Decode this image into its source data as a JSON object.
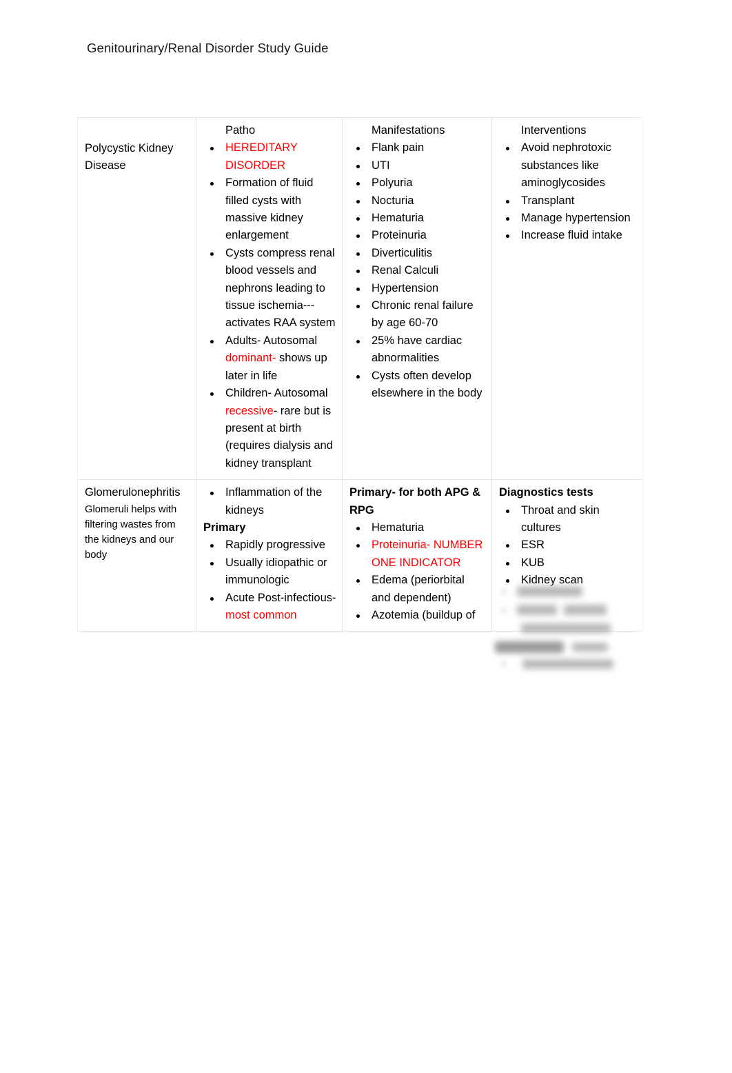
{
  "document": {
    "title": "Genitourinary/Renal Disorder Study Guide"
  },
  "colors": {
    "highlight_red": "#ff0000",
    "text": "#000000",
    "table_border": "#e2e2e2"
  },
  "table": {
    "headers": {
      "col1": "",
      "col2": "Patho",
      "col3": "Manifestations",
      "col4": "Interventions"
    },
    "rows": [
      {
        "name": "polycystic-kidney-disease",
        "disorder": {
          "title": "Polycystic Kidney Disease",
          "note": ""
        },
        "patho": {
          "bullets": [
            {
              "text": "HEREDITARY DISORDER",
              "color": "red"
            },
            {
              "text": "Formation of fluid filled cysts with massive kidney enlargement"
            },
            {
              "text": "Cysts compress renal blood vessels and nephrons leading to tissue ischemia---activates RAA system"
            },
            {
              "pre": "Adults- Autosomal ",
              "em": "dominant-",
              "post": " shows up later in life"
            },
            {
              "pre": "Children- Autosomal ",
              "em": "recessive",
              "post": "- rare but is present at birth (requires dialysis and kidney transplant"
            }
          ]
        },
        "manifestations": {
          "bullets": [
            {
              "text": "Flank pain"
            },
            {
              "text": "UTI"
            },
            {
              "text": "Polyuria"
            },
            {
              "text": "Nocturia"
            },
            {
              "text": "Hematuria"
            },
            {
              "text": "Proteinuria"
            },
            {
              "text": "Diverticulitis"
            },
            {
              "text": "Renal Calculi"
            },
            {
              "text": "Hypertension"
            },
            {
              "text": "Chronic renal failure by age 60-70"
            },
            {
              "text": "25% have cardiac abnormalities"
            },
            {
              "text": "Cysts often develop elsewhere in the body"
            }
          ]
        },
        "interventions": {
          "bullets": [
            {
              "text": "Avoid nephrotoxic substances like aminoglycosides"
            },
            {
              "text": "Transplant"
            },
            {
              "text": "Manage hypertension"
            },
            {
              "text": "Increase fluid intake"
            }
          ]
        }
      },
      {
        "name": "glomerulonephritis",
        "disorder": {
          "title": "Glomerulonephritis",
          "note": "Glomeruli helps with filtering wastes from the kidneys and our body"
        },
        "patho": {
          "lead_bullets": [
            {
              "text": "Inflammation of the kidneys"
            }
          ],
          "subhead": "Primary",
          "bullets": [
            {
              "text": "Rapidly progressive"
            },
            {
              "text": "Usually idiopathic or immunologic"
            },
            {
              "pre": "Acute Post-infectious- ",
              "em": "most common",
              "post": ""
            }
          ]
        },
        "manifestations": {
          "subhead": "Primary- for both APG & RPG",
          "bullets": [
            {
              "text": "Hematuria"
            },
            {
              "text": "Proteinuria- NUMBER ONE INDICATOR",
              "color": "red"
            },
            {
              "text": "Edema (periorbital and dependent)"
            },
            {
              "text": "Azotemia (buildup of"
            }
          ]
        },
        "interventions": {
          "subhead": "Diagnostics tests",
          "bullets": [
            {
              "text": "Throat and skin cultures"
            },
            {
              "text": "ESR"
            },
            {
              "text": "KUB"
            },
            {
              "text": "Kidney scan"
            }
          ],
          "obscured": true
        }
      }
    ]
  }
}
